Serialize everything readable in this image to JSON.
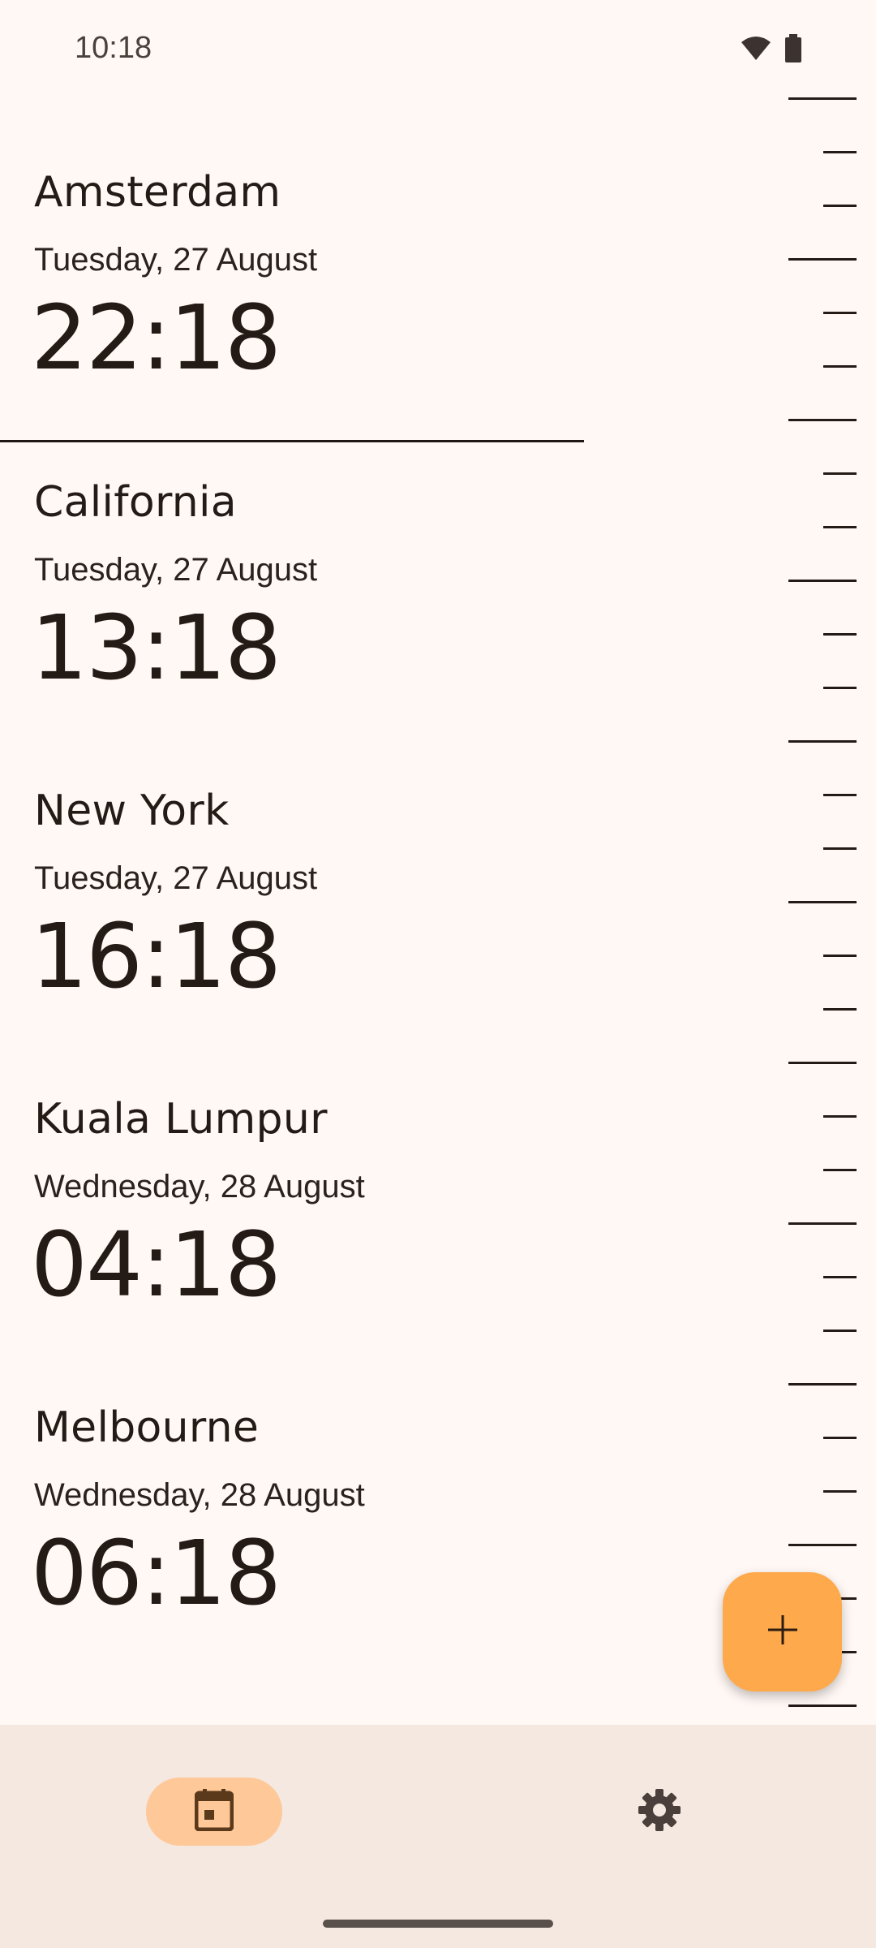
{
  "status_bar": {
    "time": "10:18",
    "icons": [
      "wifi-icon",
      "battery-icon"
    ]
  },
  "clocks": [
    {
      "city": "Amsterdam",
      "date": "Tuesday, 27 August",
      "time": "22:18"
    },
    {
      "city": "California",
      "date": "Tuesday, 27 August",
      "time": "13:18"
    },
    {
      "city": "New York",
      "date": "Tuesday, 27 August",
      "time": "16:18"
    },
    {
      "city": "Kuala Lumpur",
      "date": "Wednesday, 28 August",
      "time": "04:18"
    },
    {
      "city": "Melbourne",
      "date": "Wednesday, 28 August",
      "time": "06:18"
    }
  ],
  "fab": {
    "icon": "plus-icon"
  },
  "bottom_nav": {
    "items": [
      {
        "icon": "calendar-icon",
        "selected": true
      },
      {
        "icon": "gear-icon",
        "selected": false
      }
    ]
  },
  "colors": {
    "background": "#fff8f5",
    "accent": "#ffa94d",
    "nav_selected": "#ffc898",
    "nav_background": "#f4e8e0",
    "text": "#241a16"
  }
}
